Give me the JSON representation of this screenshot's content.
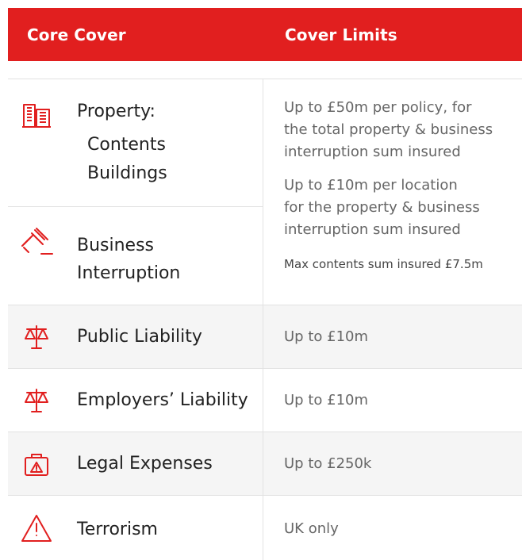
{
  "colors": {
    "accent": "#e11f1f",
    "shaded_row": "#f5f5f5",
    "divider": "#e2e2e2"
  },
  "header": {
    "core_cover": "Core Cover",
    "cover_limits": "Cover Limits"
  },
  "rows": {
    "property": {
      "icon": "buildings-icon",
      "label_line1": "Property:",
      "label_line2": "Contents",
      "label_line3": "Buildings"
    },
    "business_interruption": {
      "icon": "gavel-icon",
      "label_line1": "Business",
      "label_line2": "Interruption"
    },
    "property_limits": {
      "p1_line1": "Up to £50m per policy, for",
      "p1_line2": "the total property & business",
      "p1_line3": "interruption sum insured",
      "p2_line1": "Up to £10m per location",
      "p2_line2": "for the property & business",
      "p2_line3": "interruption sum insured",
      "p3": "Max contents sum insured £7.5m"
    },
    "public_liability": {
      "icon": "scales-icon",
      "label": "Public Liability",
      "limit": "Up to £10m"
    },
    "employers_liability": {
      "icon": "scales-icon",
      "label": "Employers’ Liability",
      "limit": "Up to £10m"
    },
    "legal_expenses": {
      "icon": "briefcase-warning-icon",
      "label": "Legal Expenses",
      "limit": "Up to £250k"
    },
    "terrorism": {
      "icon": "warning-triangle-icon",
      "label": "Terrorism",
      "limit": "UK only"
    }
  }
}
